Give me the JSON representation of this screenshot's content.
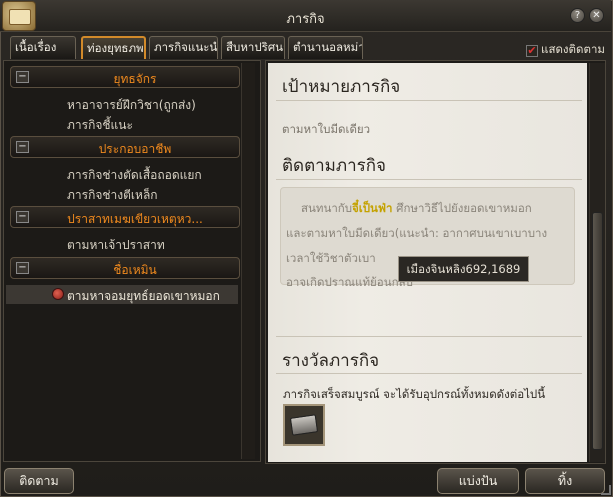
{
  "window": {
    "title": "ภารกิจ",
    "help_icon": "question-icon",
    "close_icon": "close-icon"
  },
  "tabs": [
    {
      "label": "เนื้อเรื่อง"
    },
    {
      "label": "ท่องยุทธภพ"
    },
    {
      "label": "ภารกิจแนะนำ"
    },
    {
      "label": "สืบหาปริศนา"
    },
    {
      "label": "ตำนานอลหม่าน"
    }
  ],
  "track_toggle": {
    "label": "แสดงติดตาม",
    "checked": true
  },
  "quest_tree": {
    "categories": [
      {
        "label": "ยุทธจักร",
        "items": [
          "หาอาจารย์ฝึกวิชา(ถูกส่ง)",
          "ภารกิจชี้แนะ"
        ]
      },
      {
        "label": "ประกอบอาชีพ",
        "items": [
          "ภารกิจช่างตัดเสื้อถอดแยก",
          "ภารกิจช่างตีเหล็ก"
        ]
      },
      {
        "label": "ปราสาทเมฆเขียวเหตุหว...",
        "items": [
          "ตามหาเจ้าปราสาท"
        ]
      },
      {
        "label": "ชื่อเหมิน",
        "items": [
          "ตามหาจอมยุทธ์ยอดเขาหมอก"
        ]
      }
    ]
  },
  "detail": {
    "goal_heading": "เป้าหมายภารกิจ",
    "goal_text": "ตามหาใบมีดเดียว",
    "track_heading": "ติดตามภารกิจ",
    "desc_lines": [
      {
        "pre": "สนทนากับ",
        "npc": "จี๋เป็นฟ่า",
        "post": " ศึกษาวิธีไปยังยอดเขาหมอก"
      },
      {
        "text": "และตามหาใบมีดเดียว(แนะนำ: อากาศบนเขาเบาบาง"
      },
      {
        "text": "เวลาใช้วิชาตัวเบา"
      },
      {
        "text": "อาจเกิดปราณแท้ย้อนกลับ"
      }
    ],
    "tooltip": "เมืองจินหลิง692,1689",
    "reward_heading": "รางวัลภารกิจ",
    "reward_text": "ภารกิจเสร็จสมบูรณ์ จะได้รับอุปกรณ์ทั้งหมดดังต่อไปนี้",
    "reward_items": [
      "item-box-icon"
    ]
  },
  "buttons": {
    "track": "ติดตาม",
    "share": "แบ่งปัน",
    "abandon": "ทิ้ง"
  }
}
